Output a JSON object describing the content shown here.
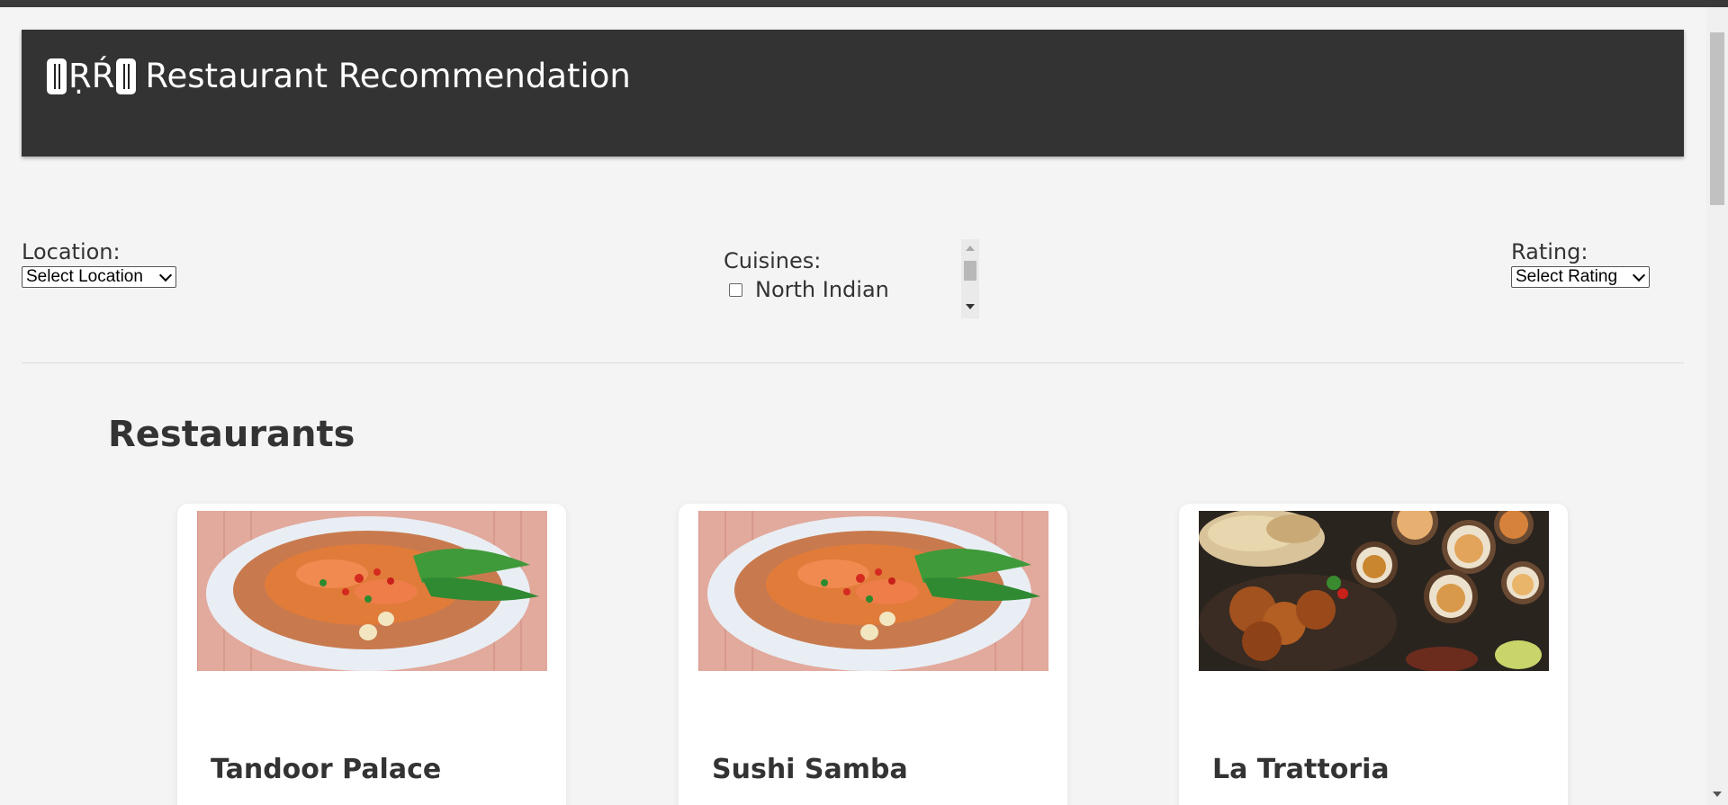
{
  "header": {
    "logo_text": "ṚŔ",
    "logo_icon": "fork-and-knife-icon",
    "title": "Restaurant Recommendation"
  },
  "filters": {
    "location": {
      "label": "Location:",
      "selected": "Select Location"
    },
    "cuisines": {
      "label": "Cuisines:",
      "options": [
        {
          "label": "North Indian",
          "checked": false
        }
      ]
    },
    "rating": {
      "label": "Rating:",
      "selected": "Select Rating"
    }
  },
  "main": {
    "section_title": "Restaurants",
    "restaurants": [
      {
        "name": "Tandoor Palace",
        "image": "noodle-soup-bowl"
      },
      {
        "name": "Sushi Samba",
        "image": "noodle-soup-bowl"
      },
      {
        "name": "La Trattoria",
        "image": "indian-food-spread"
      }
    ]
  },
  "colors": {
    "header_bg": "#333333",
    "page_bg": "#f4f4f4",
    "card_bg": "#ffffff",
    "text": "#333333"
  }
}
